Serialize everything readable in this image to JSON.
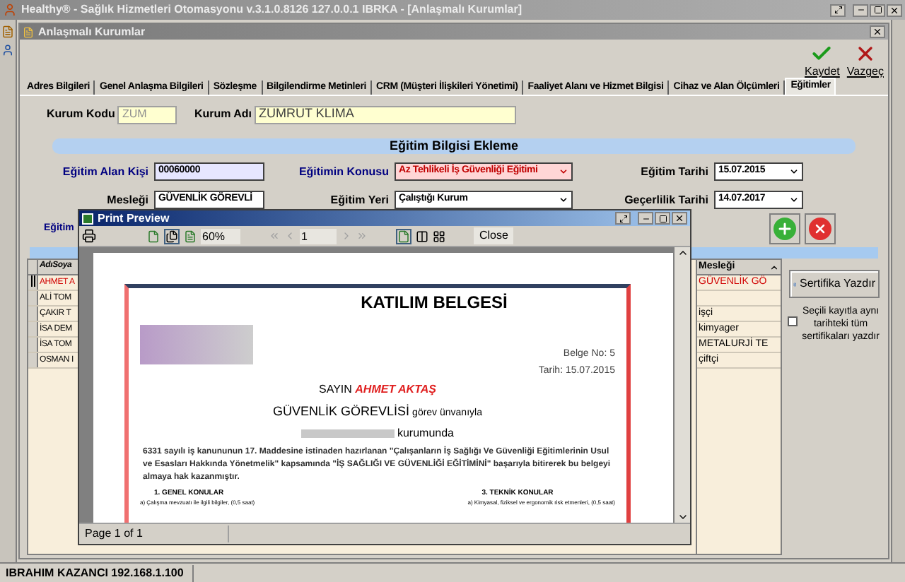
{
  "window": {
    "title": "Healthy® - Sağlık Hizmetleri Otomasyonu v.3.1.0.8126 127.0.0.1 IBRKA - [Anlaşmalı Kurumlar]"
  },
  "child_window": {
    "title": "Anlaşmalı Kurumlar"
  },
  "toolbar": [
    {
      "label": "Kaydet",
      "kind": "save"
    },
    {
      "label": "Vazgeç",
      "kind": "cancel"
    }
  ],
  "tabs": [
    {
      "label": "Adres Bilgileri",
      "selected": false
    },
    {
      "label": "Genel Anlaşma Bilgileri",
      "selected": false
    },
    {
      "label": "Sözleşme",
      "selected": false
    },
    {
      "label": "Bilgilendirme Metinleri",
      "selected": false
    },
    {
      "label": "CRM (Müşteri İlişkileri Yönetimi)",
      "selected": false
    },
    {
      "label": "Faaliyet Alanı ve Hizmet Bilgisi",
      "selected": false
    },
    {
      "label": "Cihaz ve Alan Ölçümleri",
      "selected": false
    },
    {
      "label": "Eğitimler",
      "selected": true
    }
  ],
  "institution": {
    "code_label": "Kurum Kodu",
    "code": "ZUM",
    "name_label": "Kurum Adı",
    "name": "ZUMRUT KLIMA"
  },
  "section_title": "Eğitim Bilgisi Ekleme",
  "fields": [
    {
      "label": "Eğitim Alan Kişi",
      "value": "00060000",
      "kind": "text",
      "required": true,
      "highlight": true
    },
    {
      "label": "Eğitimin Konusu",
      "value": "Az Tehlikeli İş Güvenliği Eğitimi",
      "kind": "select",
      "required": true,
      "highlight": true
    },
    {
      "label": "Eğitim Tarihi",
      "value": "15.07.2015",
      "kind": "date",
      "required": false,
      "highlight": false
    },
    {
      "label": "Mesleği",
      "value": "GÜVENLİK GÖREVLİ",
      "kind": "text",
      "required": false,
      "highlight": false
    },
    {
      "label": "Eğitim Yeri",
      "value": "Çalıştığı Kurum",
      "kind": "select",
      "required": false,
      "highlight": false
    },
    {
      "label": "Geçerlilik Tarihi",
      "value": "14.07.2017",
      "kind": "date",
      "required": false,
      "highlight": false
    }
  ],
  "row3_label": "Eğitim",
  "grid": {
    "columns": [
      "AdıSoya",
      "Mesleği"
    ],
    "rows": [
      {
        "name": "AHMET A",
        "job": "GÜVENLİK GÖ",
        "selected": true
      },
      {
        "name": "ALİ TOM",
        "job": "",
        "selected": false
      },
      {
        "name": "ÇAKIR T",
        "job": "işçi",
        "selected": false
      },
      {
        "name": "İSA DEM",
        "job": "kimyager",
        "selected": false
      },
      {
        "name": "İSA TOM",
        "job": "METALURJİ TE",
        "selected": false
      },
      {
        "name": "OSMAN I",
        "job": "çiftçi",
        "selected": false
      }
    ]
  },
  "print_button": "Sertifika Yazdır",
  "print_all": {
    "label": "Seçili kayıtla aynı tarihteki tüm sertifikaları yazdır",
    "checked": false
  },
  "status_bar": "IBRAHIM KAZANCI 192.168.1.100",
  "preview": {
    "title": "Print Preview",
    "zoom": "60%",
    "page": "1",
    "close": "Close",
    "status": "Page 1 of 1",
    "document": {
      "title": "KATILIM BELGESİ",
      "number": "Belge No: 5",
      "date": "Tarih: 15.07.2015",
      "salutation": "SAYIN **AHMET AKTAŞ**",
      "position": "GÜVENLİK GÖREVLİSİ",
      "position_suffix": "görev ünvanıyla",
      "workplace_suffix": "kurumunda",
      "body": "6331 sayılı iş kanununun 17. Maddesine istinaden hazırlanan \"Çalışanların İş Sağlığı Ve Güvenliği Eğitimlerinin Usul ve Esasları Hakkında Yönetmelik\" kapsamında \"İŞ SAĞLIĞI VE GÜVENLİĞİ EĞİTİMİNİ\" başarıyla bitirerek bu belgeyi almaya hak kazanmıştır.",
      "sections": [
        {
          "heading": "1. GENEL KONULAR",
          "item": "a) Çalışma mevzuatı ile ilgili bilgiler, (0,5 saat)"
        },
        {
          "heading": "3. TEKNİK KONULAR",
          "item": "a) Kimyasal, fiziksel ve ergonomik risk etmenleri, (0,5 saat)"
        }
      ]
    }
  }
}
